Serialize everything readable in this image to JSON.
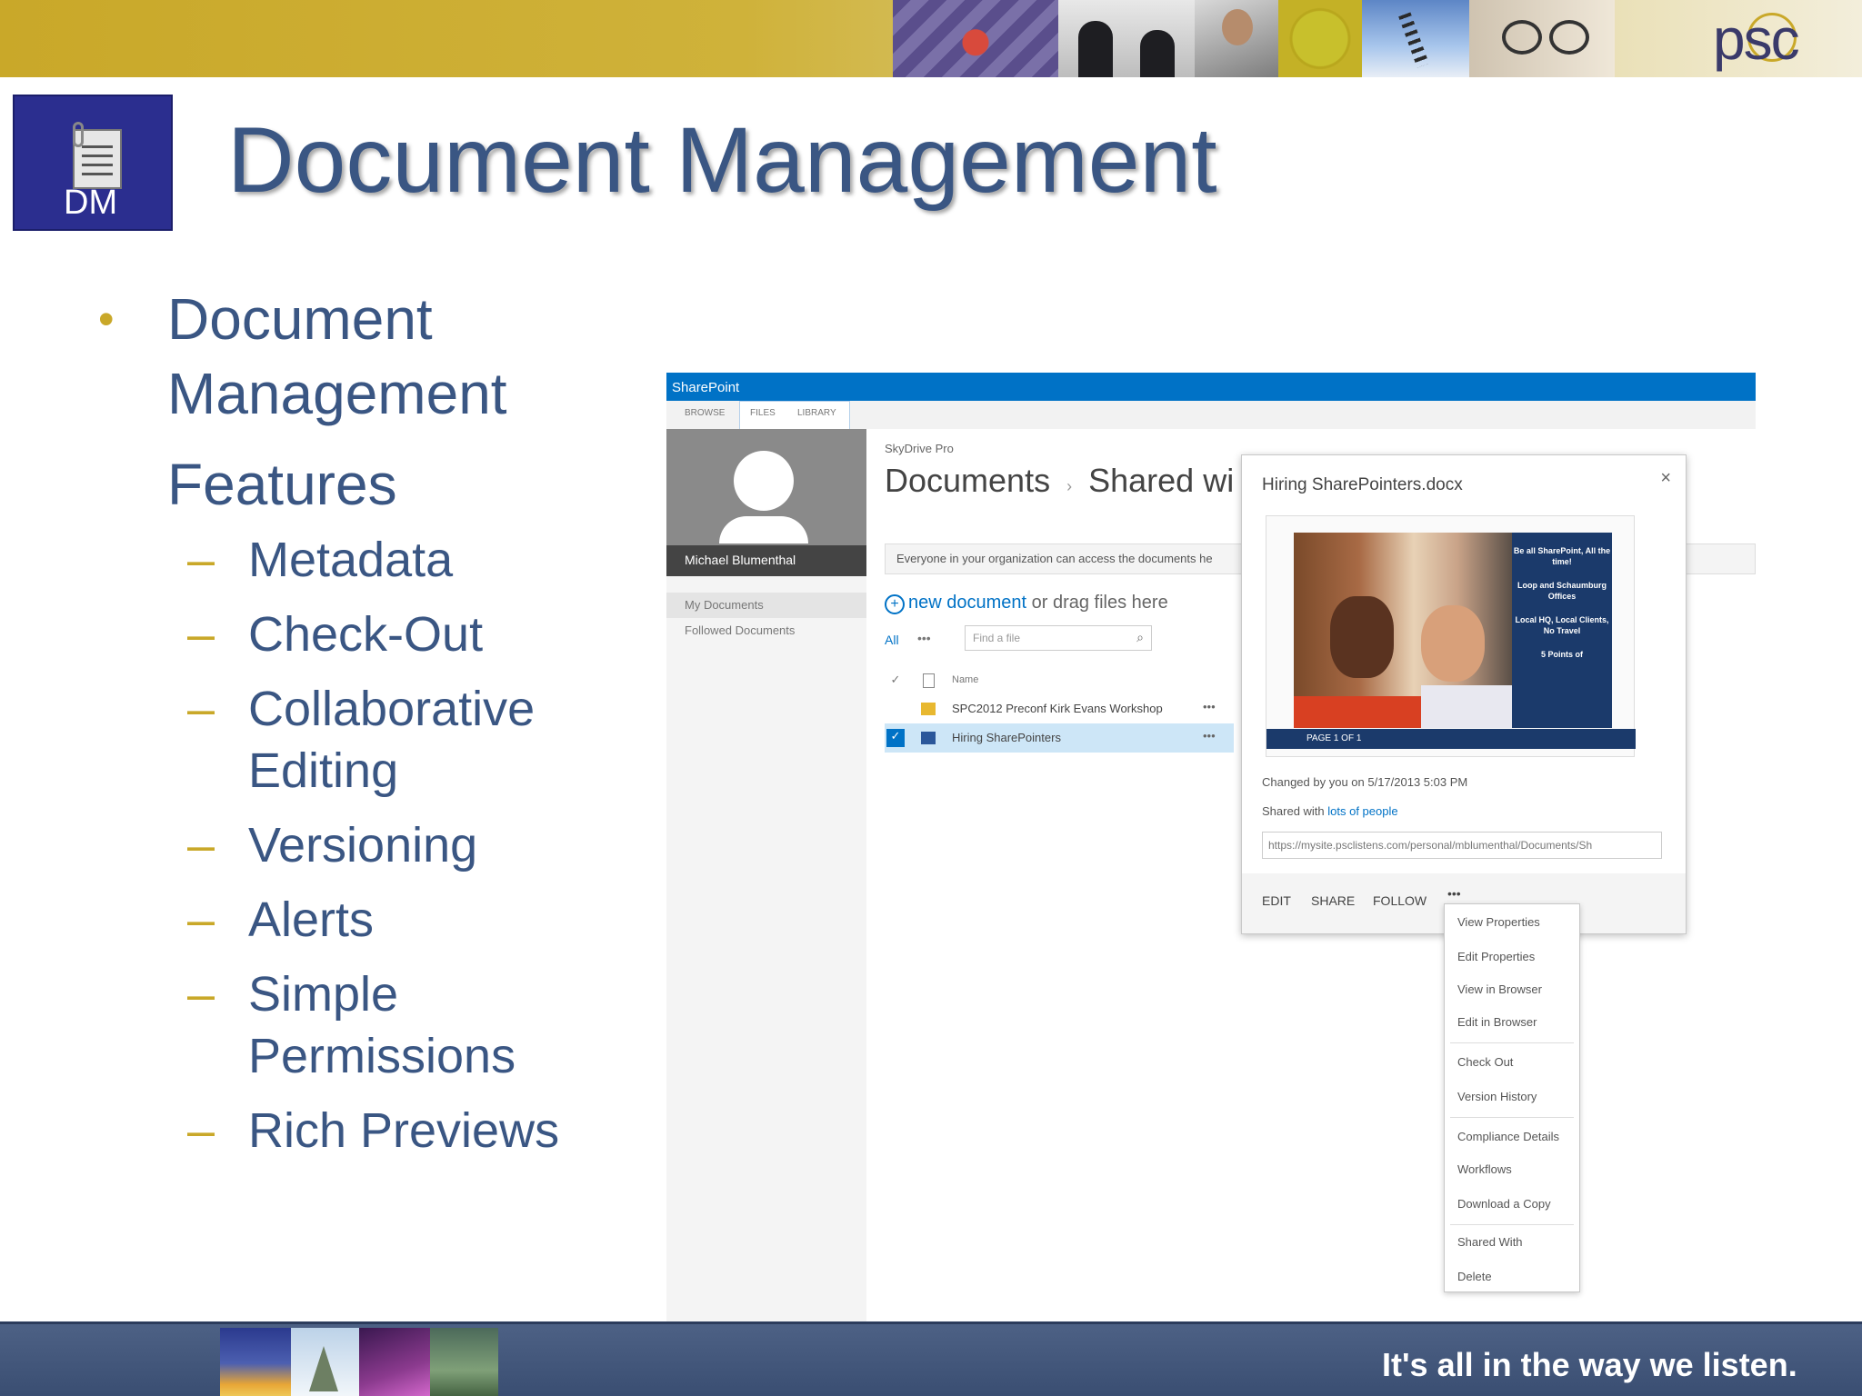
{
  "header": {
    "logo": "psc"
  },
  "slide": {
    "badge_label": "DM",
    "title": "Document Management"
  },
  "bullets": {
    "main_line1": "Document",
    "main_line2": "Management",
    "main_line3": "Features",
    "items": [
      [
        "Metadata"
      ],
      [
        "Check-Out"
      ],
      [
        "Collaborative",
        "Editing"
      ],
      [
        "Versioning"
      ],
      [
        "Alerts"
      ],
      [
        "Simple",
        "Permissions"
      ],
      [
        "Rich Previews"
      ]
    ]
  },
  "sharepoint": {
    "app_name": "SharePoint",
    "tabs": [
      "BROWSE",
      "FILES",
      "LIBRARY"
    ],
    "user_name": "Michael Blumenthal",
    "nav": [
      "My Documents",
      "Followed Documents"
    ],
    "breadcrumb": "SkyDrive Pro",
    "doc_title_a": "Documents",
    "doc_title_sep": "›",
    "doc_title_b": "Shared wi",
    "info_bar": "Everyone in your organization can access the documents he",
    "new_document_link": "new document",
    "new_document_rest": " or drag files here",
    "view_all": "All",
    "view_more": "•••",
    "find_placeholder": "Find a file",
    "column_name": "Name",
    "rows": [
      {
        "name": "SPC2012 Preconf Kirk Evans Workshop",
        "dots": "•••"
      },
      {
        "name": "Hiring SharePointers",
        "dots": "•••"
      }
    ]
  },
  "callout": {
    "file_name": "Hiring SharePointers.docx",
    "close": "×",
    "preview_panel": [
      "Be all SharePoint, All the time!",
      "Loop and Schaumburg Offices",
      "Local HQ, Local Clients, No Travel",
      "5 Points of"
    ],
    "pager": "PAGE 1 OF 1",
    "changed_by": "Changed by you on 5/17/2013 5:03 PM",
    "shared_prefix": "Shared with ",
    "shared_link": "lots of people",
    "url": "https://mysite.psclistens.com/personal/mblumenthal/Documents/Sh",
    "actions": [
      "EDIT",
      "SHARE",
      "FOLLOW",
      "•••"
    ]
  },
  "menu": {
    "items": [
      "View Properties",
      "Edit Properties",
      "View in Browser",
      "Edit in Browser",
      "Check Out",
      "Version History",
      "Compliance Details",
      "Workflows",
      "Download a Copy",
      "Shared With",
      "Delete"
    ]
  },
  "footer": {
    "tagline": "It's all in the way we listen."
  },
  "colors": {
    "title_blue": "#3a5683",
    "accent_gold": "#c9a829",
    "sharepoint_blue": "#0072c6",
    "footer_band": "#3a4e72"
  }
}
